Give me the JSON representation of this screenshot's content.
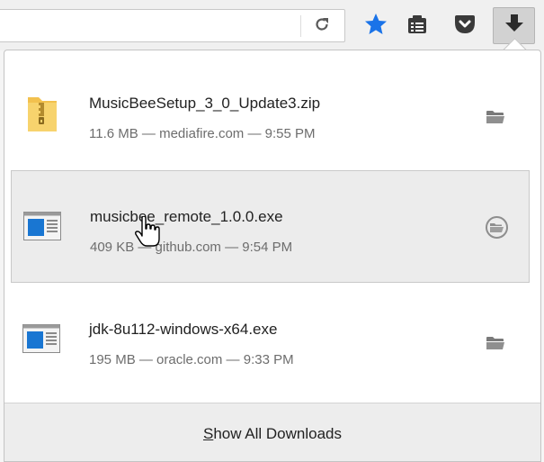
{
  "toolbar": {
    "icons": [
      "reload-icon",
      "bookmark-star-icon",
      "reading-list-icon",
      "pocket-icon",
      "download-arrow-icon"
    ],
    "star_color": "#1a73e8"
  },
  "downloads": {
    "items": [
      {
        "name": "MusicBeeSetup_3_0_Update3.zip",
        "status": "11.6 MB — mediafire.com — 9:55 PM",
        "icon": "zip-folder-icon",
        "action_icon": "open-folder-icon"
      },
      {
        "name": "musicbee_remote_1.0.0.exe",
        "status": "409 KB — github.com — 9:54 PM",
        "icon": "exe-window-icon",
        "action_icon": "open-folder-icon",
        "hovered": true
      },
      {
        "name": "jdk-8u112-windows-x64.exe",
        "status": "195 MB — oracle.com — 9:33 PM",
        "icon": "exe-window-icon",
        "action_icon": "open-folder-icon"
      }
    ],
    "footer": {
      "accesskey": "S",
      "label_rest": "how All Downloads"
    }
  }
}
